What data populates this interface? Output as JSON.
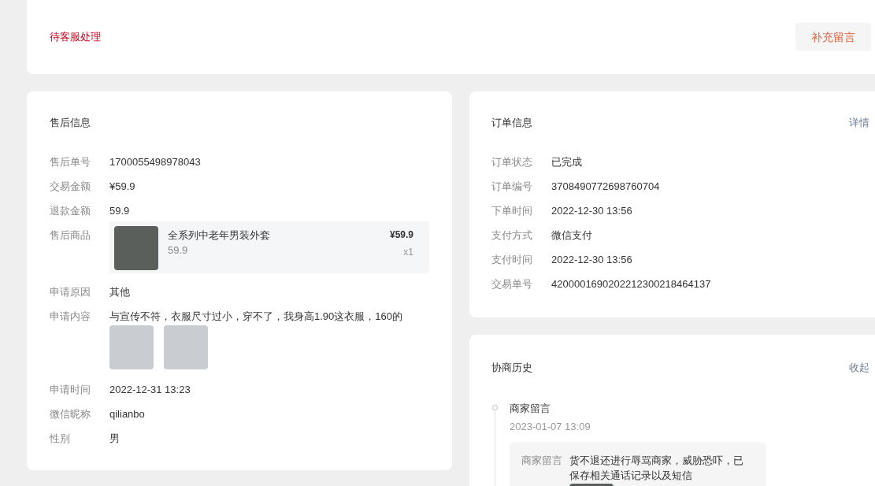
{
  "status_bar": {
    "status": "待客服处理",
    "action_button": "补充留言"
  },
  "after_sale": {
    "title": "售后信息",
    "rows": [
      {
        "kind": "text",
        "label": "售后单号",
        "value": "1700055498978043"
      },
      {
        "kind": "text",
        "label": "交易金额",
        "value": "¥59.9"
      },
      {
        "kind": "text",
        "label": "退款金额",
        "value": "59.9"
      },
      {
        "kind": "product",
        "label": "售后商品",
        "name": "全系列中老年男装外套",
        "spec": "59.9",
        "price": "¥59.9",
        "quantity": "x1"
      },
      {
        "kind": "text",
        "label": "申请原因",
        "value": "其他"
      },
      {
        "kind": "photos",
        "label": "申请内容",
        "value": "与宣传不符，衣服尺寸过小，穿不了，我身高1.90这衣服，160的",
        "photos": [
          {
            "kind": "photo"
          },
          {
            "kind": "photo"
          }
        ]
      },
      {
        "kind": "text",
        "label": "申请时间",
        "value": "2022-12-31 13:23"
      },
      {
        "kind": "text",
        "label": "微信昵称",
        "value": "qilianbo"
      },
      {
        "kind": "text",
        "label": "性别",
        "value": "男"
      }
    ]
  },
  "order": {
    "title": "订单信息",
    "link": "详情",
    "rows": [
      {
        "label": "订单状态",
        "value": "已完成"
      },
      {
        "label": "订单编号",
        "value": "3708490772698760704"
      },
      {
        "label": "下单时间",
        "value": "2022-12-30 13:56"
      },
      {
        "label": "支付方式",
        "value": "微信支付"
      },
      {
        "label": "支付时间",
        "value": "2022-12-30 13:56"
      },
      {
        "label": "交易单号",
        "value": "4200001690202212300218464137"
      }
    ]
  },
  "history": {
    "title": "协商历史",
    "link": "收起",
    "entries": [
      {
        "title": "商家留言",
        "time": "2023-01-07 13:09",
        "label": "商家留言",
        "message": "货不退还进行辱骂商家，威胁恐吓，已保存相关通话记录以及短信",
        "photos": [
          {
            "kind": "photo"
          }
        ]
      }
    ]
  }
}
